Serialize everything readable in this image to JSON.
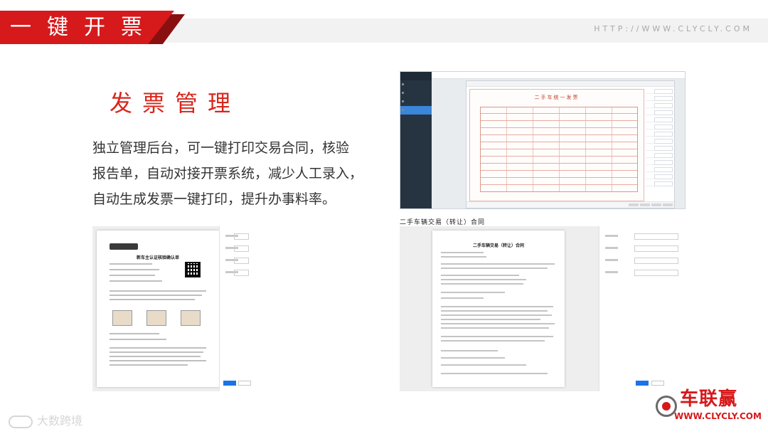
{
  "header": {
    "title": "一键开票",
    "url_text": "HTTP://WWW.CLYCLY.COM"
  },
  "section": {
    "heading": "发票管理",
    "body_lines": [
      "独立管理后台，可一键打印交易合同，核验",
      "报告单，自动对接开票系统，减少人工录入，",
      "自动生成发票一键打印，提升办事料率。"
    ]
  },
  "screenshots": {
    "invoice_title": "二手车统一发票",
    "certificate_title": "新车主认证核验确认单",
    "contract_title": "二手车辆交易（转让）合同",
    "contract_caption": "二手车辆交易（转让）合同"
  },
  "footer": {
    "watermark_left": "大数跨境",
    "brand_name": "车联赢",
    "brand_url": "WWW.CLYCLY.COM"
  },
  "colors": {
    "accent": "#d6191b",
    "heading": "#d8261c",
    "body_text": "#333333"
  }
}
